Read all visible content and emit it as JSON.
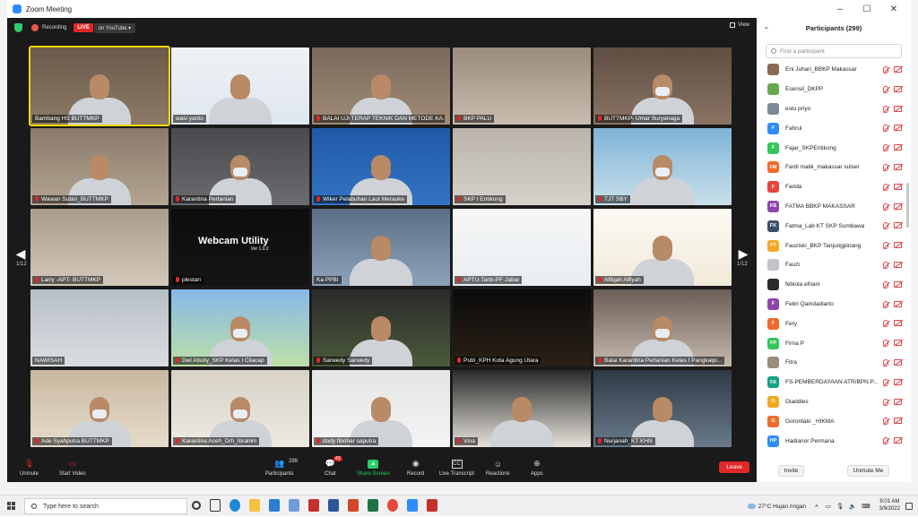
{
  "window": {
    "title": "Zoom Meeting",
    "controls": [
      "–",
      "☐",
      "✕"
    ]
  },
  "topbar": {
    "recording_label": "Recording",
    "live_label": "LIVE",
    "live_destination": "on YouTube",
    "view_label": "View"
  },
  "gallery": {
    "page_left": "1/12",
    "page_right": "1/12",
    "tiles": [
      {
        "name": "Bambang HS BUTTMKP",
        "mic_muted": false,
        "active": true
      },
      {
        "name": "wasi yanto",
        "mic_muted": false
      },
      {
        "name": "BALAI UJI TERAP TEKNIK DAN METODE KA...",
        "mic_muted": true
      },
      {
        "name": "BKP PALU",
        "mic_muted": true
      },
      {
        "name": "BUTTMKP- Umar Suryanaga",
        "mic_muted": true
      },
      {
        "name": "Wawan Sutan_BUTTMKP",
        "mic_muted": true
      },
      {
        "name": "Karantina Pertanian",
        "mic_muted": true
      },
      {
        "name": "Wiker Pelabuhan Laut Merauke",
        "mic_muted": true
      },
      {
        "name": "SKP I Entikong",
        "mic_muted": true
      },
      {
        "name": "TJT SBY",
        "mic_muted": true
      },
      {
        "name": "Larry -APT- BUTTMKP",
        "mic_muted": true
      },
      {
        "name": "plestari",
        "mic_muted": true
      },
      {
        "name": "Ka PPBI",
        "mic_muted": false
      },
      {
        "name": "APTU-Tarbi-PF-Jabar",
        "mic_muted": true
      },
      {
        "name": "Alfiqah Alfiyah",
        "mic_muted": true
      },
      {
        "name": "NAWISAH",
        "mic_muted": false
      },
      {
        "name": "Dwi Atiutiy_SKP Kelas I Cilacap",
        "mic_muted": true
      },
      {
        "name": "Sarwedy Sarwedy",
        "mic_muted": true
      },
      {
        "name": "Putri_KPH Kota Agung Utara",
        "mic_muted": true
      },
      {
        "name": "Balai Karantina Pertanian Kelas I Pangkalpi...",
        "mic_muted": true
      },
      {
        "name": "Ade Syahputra BUTTMKP",
        "mic_muted": true
      },
      {
        "name": "Karantina Aceh_Drh_Ibrahim",
        "mic_muted": true
      },
      {
        "name": "dody fibrihar saputra",
        "mic_muted": true
      },
      {
        "name": "Vina",
        "mic_muted": true
      },
      {
        "name": "Nurjanah_KT KHN",
        "mic_muted": true
      }
    ],
    "webcam_utility": {
      "title": "Webcam Utility",
      "version": "Ver 1.0.2"
    }
  },
  "toolbar": {
    "unmute": "Unmute",
    "start_video": "Start Video",
    "participants": "Participants",
    "participants_count": "299",
    "chat": "Chat",
    "chat_badge": "43",
    "share_screen": "Share Screen",
    "record": "Record",
    "live_transcript": "Live Transcript",
    "reactions": "Reactions",
    "apps": "Apps",
    "leave": "Leave"
  },
  "participants_panel": {
    "title": "Participants (299)",
    "search_placeholder": "Find a participant",
    "invite": "Invite",
    "unmute_me": "Unmute Me",
    "list": [
      {
        "name": "Eni Juhari_BBKP Makassar",
        "initials": "",
        "color": "#8a6a52"
      },
      {
        "name": "Esensil_DKPP",
        "initials": "",
        "color": "#6aa84f"
      },
      {
        "name": "estu priyo",
        "initials": "",
        "color": "#7b8a99"
      },
      {
        "name": "Fahrul",
        "initials": "F",
        "color": "#2d8cff"
      },
      {
        "name": "Fajar_SKPEntikong",
        "initials": "F",
        "color": "#34c759"
      },
      {
        "name": "Fardi malik_makassar sulsel",
        "initials": "FM",
        "color": "#f26b2a"
      },
      {
        "name": "Farida",
        "initials": "F",
        "color": "#e8453c"
      },
      {
        "name": "FATMA BBKP MAKASSAR",
        "initials": "FB",
        "color": "#8e44ad"
      },
      {
        "name": "Fatma_Lab KT SKP Sumbawa",
        "initials": "FK",
        "color": "#3d4f66"
      },
      {
        "name": "Fauziski_BKP Tanjungpinang",
        "initials": "FT",
        "color": "#f5a623"
      },
      {
        "name": "Fauzi",
        "initials": "",
        "color": "#c0c4c9"
      },
      {
        "name": "febiola efriani",
        "initials": "",
        "color": "#2b2b2b"
      },
      {
        "name": "Febri Qaindadiarto",
        "initials": "F",
        "color": "#8e44ad"
      },
      {
        "name": "Fery",
        "initials": "F",
        "color": "#f26b2a"
      },
      {
        "name": "Firna P",
        "initials": "FP",
        "color": "#34c759"
      },
      {
        "name": "Fitra",
        "initials": "",
        "color": "#9b8b7a"
      },
      {
        "name": "FS-PEMBERDAYAAN ATR/BPN P...",
        "initials": "FA",
        "color": "#16a085"
      },
      {
        "name": "Gladdies",
        "initials": "G",
        "color": "#f5a623"
      },
      {
        "name": "Gorontalo _HIKMA",
        "initials": "G",
        "color": "#f26b2a"
      },
      {
        "name": "Hadianor Permana",
        "initials": "HP",
        "color": "#2d8cff"
      }
    ]
  },
  "taskbar": {
    "search_placeholder": "Type here to search",
    "weather": "27°C  Hujan ringan",
    "time": "9:01 AM",
    "date": "3/9/2022"
  }
}
